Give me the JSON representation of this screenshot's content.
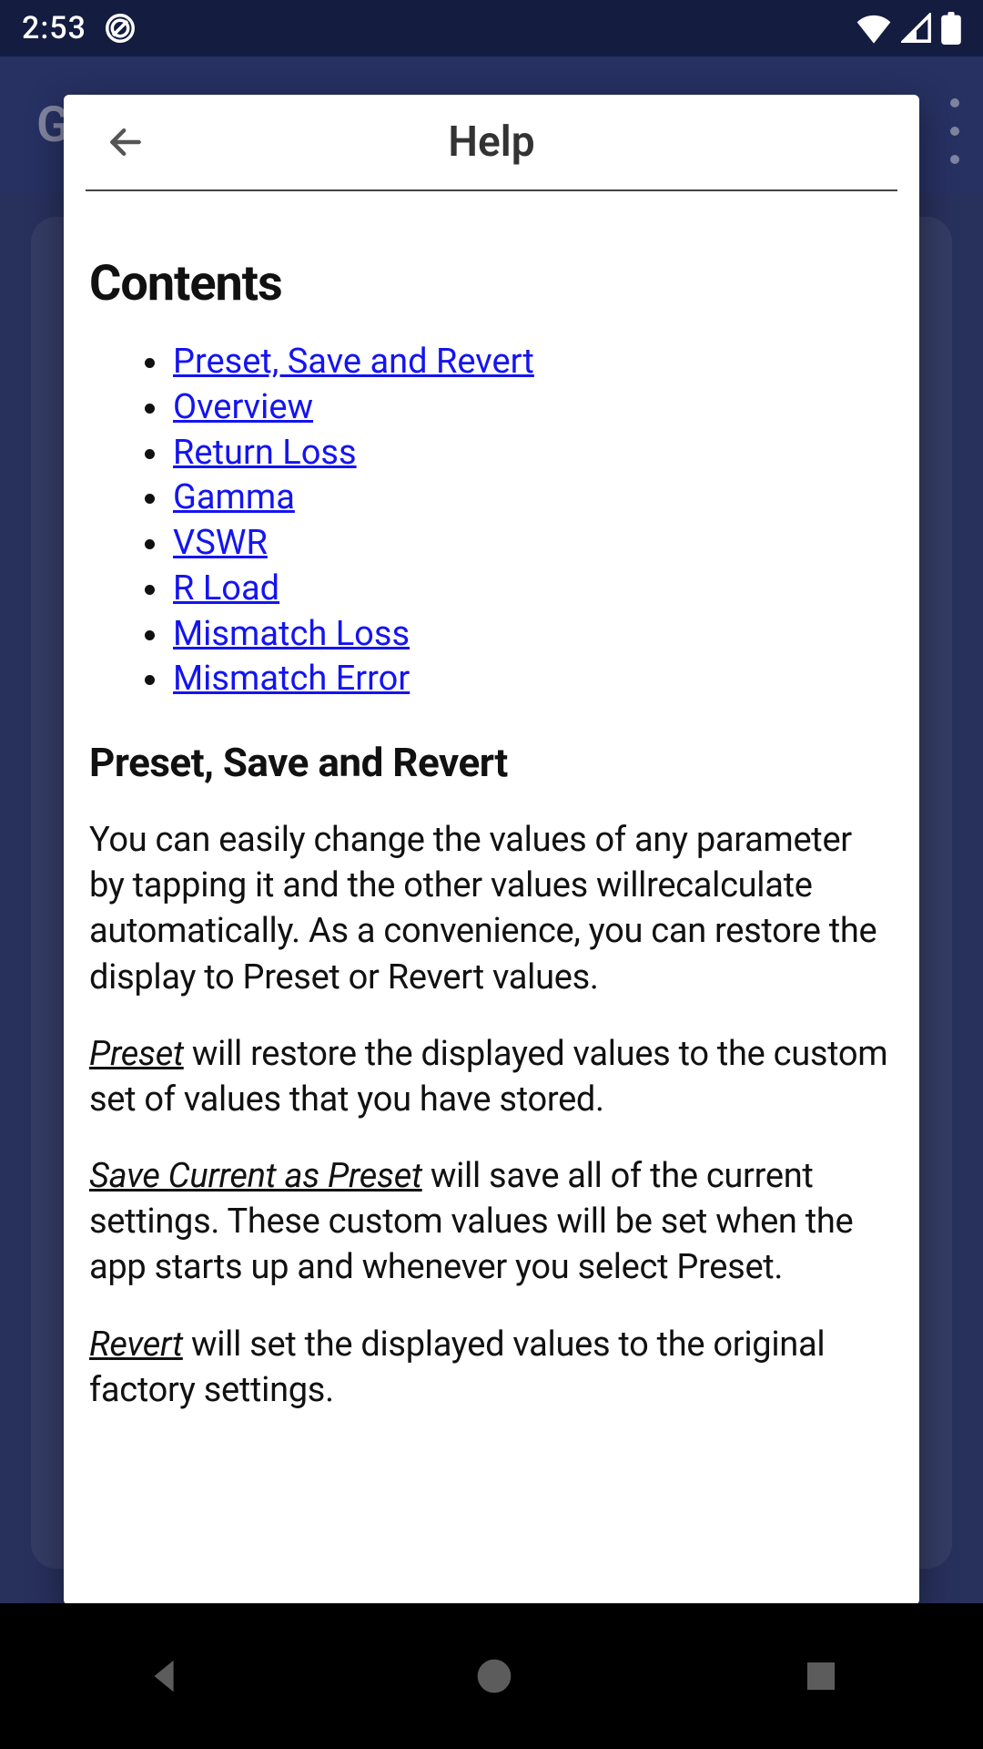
{
  "status_bar": {
    "time": "2:53",
    "icons": [
      "dnd-icon",
      "wifi-icon",
      "signal-icon",
      "battery-icon"
    ]
  },
  "app_header": {
    "title_partial": "G"
  },
  "dialog": {
    "title": "Help"
  },
  "content": {
    "contents_heading": "Contents",
    "toc": [
      "Preset, Save and Revert",
      "Overview",
      "Return Loss",
      "Gamma",
      "VSWR",
      "R Load",
      "Mismatch Loss",
      "Mismatch Error"
    ],
    "section1_heading": "Preset, Save and Revert",
    "para1": "You can easily change the values of any parameter by tapping it and the other values willrecalculate automatically. As a convenience, you can restore the display to Preset or Revert values.",
    "term_preset": "Preset",
    "para2_rest": " will restore the displayed values to the custom set of values that you have stored.",
    "term_save": "Save Current as Preset",
    "para3_rest": " will save all of the current settings. These custom values will be set when the app starts up and whenever you select Preset.",
    "term_revert": "Revert",
    "para4_rest": " will set the displayed values to the original factory settings."
  }
}
